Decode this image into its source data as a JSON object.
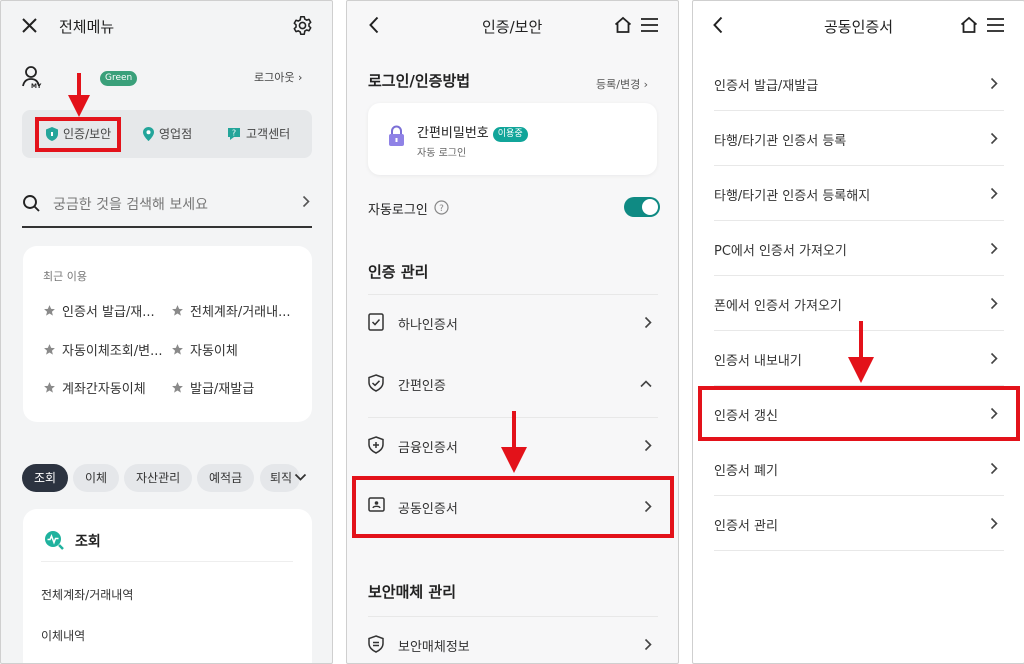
{
  "panel1": {
    "header": {
      "title": "전체메뉴",
      "close_icon": "close-icon",
      "settings_icon": "gear-icon"
    },
    "profile": {
      "icon_label": "MY",
      "grade_badge": "Green",
      "logout": "로그아웃"
    },
    "quick_menu": [
      {
        "label": "인증/보안",
        "icon": "shield-icon"
      },
      {
        "label": "영업점",
        "icon": "location-pin-icon"
      },
      {
        "label": "고객센터",
        "icon": "help-chat-icon"
      }
    ],
    "search": {
      "placeholder": "궁금한 것을 검색해 보세요"
    },
    "recent": {
      "title": "최근 이용",
      "items": [
        "인증서 발급/재...",
        "전체계좌/거래내...",
        "자동이체조회/변...",
        "자동이체",
        "계좌간자동이체",
        "발급/재발급"
      ]
    },
    "tabs": [
      "조회",
      "이체",
      "자산관리",
      "예적금",
      "퇴직"
    ],
    "menu_card": {
      "title": "조회",
      "items": [
        "전체계좌/거래내역",
        "이체내역"
      ]
    }
  },
  "panel2": {
    "header": {
      "title": "인증/보안"
    },
    "login_section": {
      "title": "로그인/인증방법",
      "edit_link": "등록/변경"
    },
    "login_card": {
      "name": "간편비밀번호",
      "badge": "이용중",
      "sub": "자동 로그인"
    },
    "auto_login": {
      "label": "자동로그인",
      "enabled": true
    },
    "cert_section": {
      "title": "인증 관리"
    },
    "cert_items": [
      "하나인증서",
      "간편인증",
      "금융인증서",
      "공동인증서"
    ],
    "security_section": {
      "title": "보안매체 관리"
    },
    "security_items": [
      "보안매체정보"
    ]
  },
  "panel3": {
    "header": {
      "title": "공동인증서"
    },
    "items": [
      "인증서 발급/재발급",
      "타행/타기관 인증서 등록",
      "타행/타기관 인증서 등록해지",
      "PC에서 인증서 가져오기",
      "폰에서 인증서 가져오기",
      "인증서 내보내기",
      "인증서 갱신",
      "인증서 폐기",
      "인증서 관리"
    ]
  },
  "colors": {
    "highlight": "#e3121a",
    "accent": "#0f8a83",
    "green_badge": "#3aa07a",
    "dark_chip": "#2c3340"
  }
}
